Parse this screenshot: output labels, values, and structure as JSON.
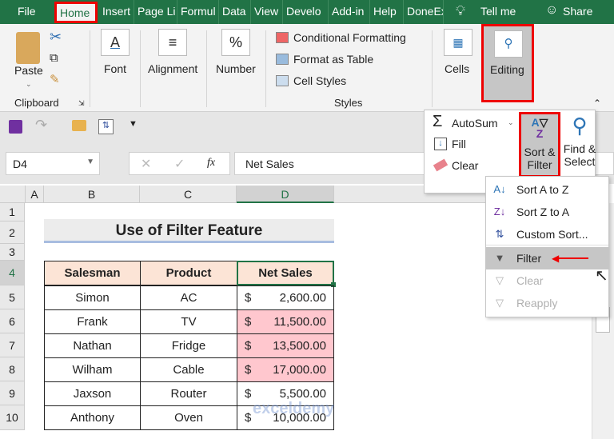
{
  "tabs": [
    "File",
    "Home",
    "Insert",
    "Page Li",
    "Formul",
    "Data",
    "View",
    "Develo",
    "Add-in",
    "Help",
    "DoneEx"
  ],
  "tell_me": "Tell me",
  "share": "Share",
  "ribbon": {
    "paste": "Paste",
    "clipboard": "Clipboard",
    "font": "Font",
    "alignment": "Alignment",
    "number": "Number",
    "conditional_formatting": "Conditional Formatting",
    "format_as_table": "Format as Table",
    "cell_styles": "Cell Styles",
    "styles": "Styles",
    "cells": "Cells",
    "editing": "Editing"
  },
  "editing_panel": {
    "autosum": "AutoSum",
    "fill": "Fill",
    "clear": "Clear",
    "sort_filter_1": "Sort &",
    "sort_filter_2": "Filter",
    "find_select_1": "Find &",
    "find_select_2": "Select"
  },
  "sort_menu": {
    "items": [
      {
        "label": "Sort A to Z",
        "enabled": true
      },
      {
        "label": "Sort Z to A",
        "enabled": true
      },
      {
        "label": "Custom Sort...",
        "enabled": true
      },
      {
        "label": "Filter",
        "enabled": true,
        "highlighted": true
      },
      {
        "label": "Clear",
        "enabled": false
      },
      {
        "label": "Reapply",
        "enabled": false
      }
    ]
  },
  "formula_bar": {
    "name_box": "D4",
    "fx": "fx",
    "value": "Net Sales"
  },
  "columns": [
    "A",
    "B",
    "C",
    "D"
  ],
  "rows": [
    "1",
    "2",
    "3",
    "4",
    "5",
    "6",
    "7",
    "8",
    "9",
    "10"
  ],
  "sheet": {
    "title": "Use of Filter Feature",
    "headers": [
      "Salesman",
      "Product",
      "Net Sales"
    ],
    "data": [
      [
        "Simon",
        "AC",
        "$",
        "2,600.00",
        false
      ],
      [
        "Frank",
        "TV",
        "$",
        "11,500.00",
        true
      ],
      [
        "Nathan",
        "Fridge",
        "$",
        "13,500.00",
        true
      ],
      [
        "Wilham",
        "Cable",
        "$",
        "17,000.00",
        true
      ],
      [
        "Jaxson",
        "Router",
        "$",
        "5,500.00",
        false
      ],
      [
        "Anthony",
        "Oven",
        "$",
        "10,000.00",
        false
      ]
    ]
  },
  "watermark": "exceldemy",
  "colors": {
    "excel_green": "#217346",
    "highlight_red": "#e00000",
    "header_fill": "#fce4d6",
    "conditional_fill": "#ffc7ce"
  }
}
